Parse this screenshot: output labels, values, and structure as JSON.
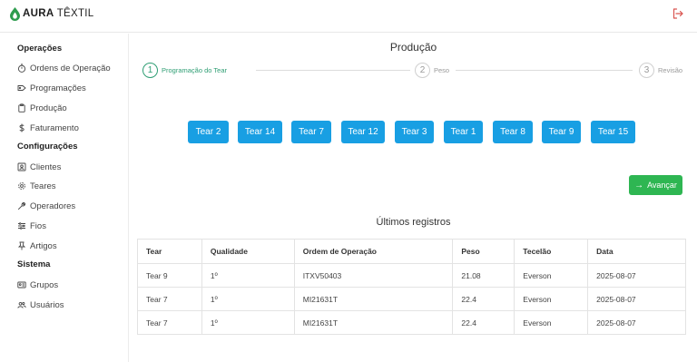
{
  "brand": {
    "name_bold": "AURA",
    "name_light": "TÊXTIL",
    "accent": "#2e9c4e"
  },
  "header": {
    "logout_icon": "logout-icon"
  },
  "sidebar": {
    "sections": [
      {
        "label": "Operações"
      },
      {
        "label": "Configurações"
      },
      {
        "label": "Sistema"
      }
    ],
    "items": [
      {
        "label": "Ordens de Operação",
        "icon": "stopwatch-icon"
      },
      {
        "label": "Programações",
        "icon": "tag-icon"
      },
      {
        "label": "Produção",
        "icon": "clipboard-icon"
      },
      {
        "label": "Faturamento",
        "icon": "dollar-icon"
      },
      {
        "label": "Clientes",
        "icon": "contact-icon"
      },
      {
        "label": "Teares",
        "icon": "gear-icon"
      },
      {
        "label": "Operadores",
        "icon": "wrench-icon"
      },
      {
        "label": "Fios",
        "icon": "sliders-icon"
      },
      {
        "label": "Artigos",
        "icon": "pin-icon"
      },
      {
        "label": "Grupos",
        "icon": "id-card-icon"
      },
      {
        "label": "Usuários",
        "icon": "users-icon"
      }
    ]
  },
  "main": {
    "title": "Produção",
    "steps": [
      {
        "number": "1",
        "label": "Programação do Tear",
        "active": true
      },
      {
        "number": "2",
        "label": "Peso",
        "active": false
      },
      {
        "number": "3",
        "label": "Revisão",
        "active": false
      }
    ],
    "tears": [
      "Tear 2",
      "Tear 14",
      "Tear 7",
      "Tear 12",
      "Tear 3",
      "Tear 1",
      "Tear 8",
      "Tear 9",
      "Tear 15"
    ],
    "tear_color": "#189fe3",
    "next_label": "Avançar",
    "next_color": "#2eb652"
  },
  "records": {
    "title": "Últimos registros",
    "columns": [
      "Tear",
      "Qualidade",
      "Ordem de Operação",
      "Peso",
      "Tecelão",
      "Data"
    ],
    "rows": [
      [
        "Tear 9",
        "1º",
        "ITXV50403",
        "21.08",
        "Everson",
        "2025-08-07"
      ],
      [
        "Tear 7",
        "1º",
        "MI21631T",
        "22.4",
        "Everson",
        "2025-08-07"
      ],
      [
        "Tear 7",
        "1º",
        "MI21631T",
        "22.4",
        "Everson",
        "2025-08-07"
      ]
    ]
  }
}
